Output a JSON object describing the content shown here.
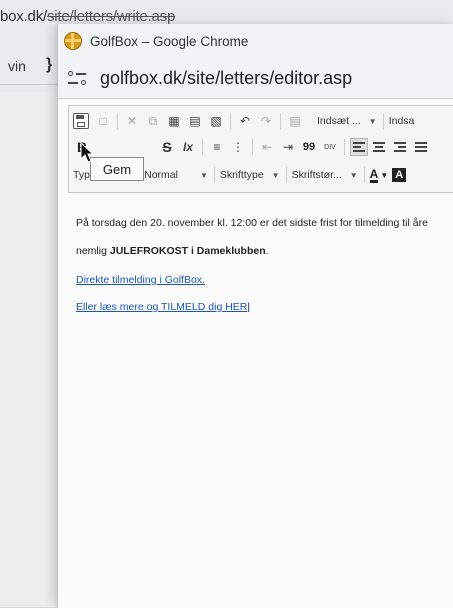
{
  "background": {
    "url_left": "box.dk/",
    "url_struck": "site/letters/write.asp",
    "side_text": "vin",
    "side_glyph": "}"
  },
  "window": {
    "title": "GolfBox – Google Chrome",
    "url": "golfbox.dk/site/letters/editor.asp"
  },
  "toolbar": {
    "insert_label": "Indsæt ...",
    "insert_label2": "Indsa",
    "bold": "B",
    "strike": "S",
    "remove_format": "Ix",
    "quote": "99",
    "source": "DIV",
    "typography": "Typografi",
    "format": "Normal",
    "font": "Skrifttype",
    "size": "Skriftstør...",
    "text_color": "A",
    "bg_color": "A"
  },
  "tooltip": {
    "text": "Gem"
  },
  "content": {
    "line1": "På torsdag den 20. november kl. 12:00 er det sidste frist for tilmelding til åre",
    "line2_prefix": "nemlig ",
    "line2_bold": "JULEFROKOST i Dameklubben",
    "line2_suffix": ".",
    "link1": "Direkte tilmelding i GolfBox.",
    "link2": "Eller læs mere og TILMELD dig HER"
  }
}
